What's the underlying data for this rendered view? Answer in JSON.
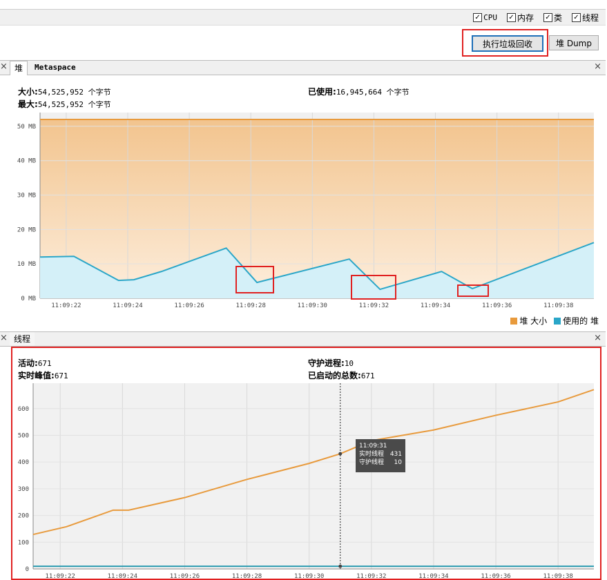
{
  "toolbar": {
    "checkboxes": [
      {
        "label": "CPU",
        "checked": true
      },
      {
        "label": "内存",
        "checked": true
      },
      {
        "label": "类",
        "checked": true
      },
      {
        "label": "线程",
        "checked": true
      }
    ],
    "gc_button": "执行垃圾回收",
    "dump_button": "堆 Dump"
  },
  "heap": {
    "tabs": [
      "堆",
      "Metaspace"
    ],
    "size_label": "大小:",
    "size_value": "54,525,952 个字节",
    "max_label": "最大:",
    "max_value": "54,525,952 个字节",
    "used_label": "已使用:",
    "used_value": "16,945,664 个字节",
    "legend": [
      {
        "label": "堆 大小",
        "color": "#e89a3c"
      },
      {
        "label": "使用的 堆",
        "color": "#2aa6c8"
      }
    ]
  },
  "threads": {
    "title": "线程",
    "live_label": "活动:",
    "live_value": "671",
    "peak_label": "实时峰值:",
    "peak_value": "671",
    "daemon_label": "守护进程:",
    "daemon_value": "10",
    "total_label": "已启动的总数:",
    "total_value": "671",
    "tooltip": {
      "time": "11:09:31",
      "rows": [
        {
          "label": "实时线程",
          "value": "431"
        },
        {
          "label": "守护线程",
          "value": "10"
        }
      ]
    }
  },
  "chart_data": [
    {
      "type": "area",
      "title": "堆",
      "ylabel": "MB",
      "ylim": [
        0,
        54
      ],
      "yticks": [
        "0 MB",
        "10 MB",
        "20 MB",
        "30 MB",
        "40 MB",
        "50 MB"
      ],
      "ytick_values": [
        0,
        10,
        20,
        30,
        40,
        50
      ],
      "xticks": [
        "11:09:22",
        "11:09:24",
        "11:09:26",
        "11:09:28",
        "11:09:30",
        "11:09:32",
        "11:09:34",
        "11:09:36",
        "11:09:38"
      ],
      "xtick_values": [
        22,
        24,
        26,
        28,
        30,
        32,
        34,
        36,
        38
      ],
      "xlim": [
        21.15,
        39.15
      ],
      "series": [
        {
          "name": "堆 大小",
          "x": [
            21.15,
            39.15
          ],
          "y": [
            52,
            52
          ]
        },
        {
          "name": "使用的 堆",
          "x": [
            21.15,
            22.25,
            23.7,
            24.2,
            25.1,
            27.2,
            28.2,
            31.2,
            32.2,
            34.2,
            35.2,
            39.15
          ],
          "y": [
            12,
            12.2,
            5.2,
            5.4,
            7.8,
            14.6,
            4.6,
            11.4,
            2.6,
            7.8,
            2.8,
            16.2
          ]
        }
      ]
    },
    {
      "type": "line",
      "title": "线程",
      "ylim": [
        0,
        695
      ],
      "yticks": [
        "0",
        "100",
        "200",
        "300",
        "400",
        "500",
        "600"
      ],
      "ytick_values": [
        0,
        100,
        200,
        300,
        400,
        500,
        600
      ],
      "xticks": [
        "11:09:22",
        "11:09:24",
        "11:09:26",
        "11:09:28",
        "11:09:30",
        "11:09:32",
        "11:09:34",
        "11:09:36",
        "11:09:38"
      ],
      "xtick_values": [
        22,
        24,
        26,
        28,
        30,
        32,
        34,
        36,
        38
      ],
      "xlim": [
        21.13,
        39.15
      ],
      "series": [
        {
          "name": "实时线程",
          "x": [
            21.13,
            22.2,
            23.7,
            24.2,
            26,
            28,
            30,
            31,
            32,
            34,
            36,
            38,
            39.15
          ],
          "y": [
            129,
            158,
            220,
            220,
            267,
            335,
            395,
            431,
            480,
            520,
            575,
            625,
            671
          ]
        },
        {
          "name": "守护线程",
          "x": [
            21.13,
            39.15
          ],
          "y": [
            10,
            10
          ]
        }
      ],
      "cursor_x": 31
    }
  ]
}
